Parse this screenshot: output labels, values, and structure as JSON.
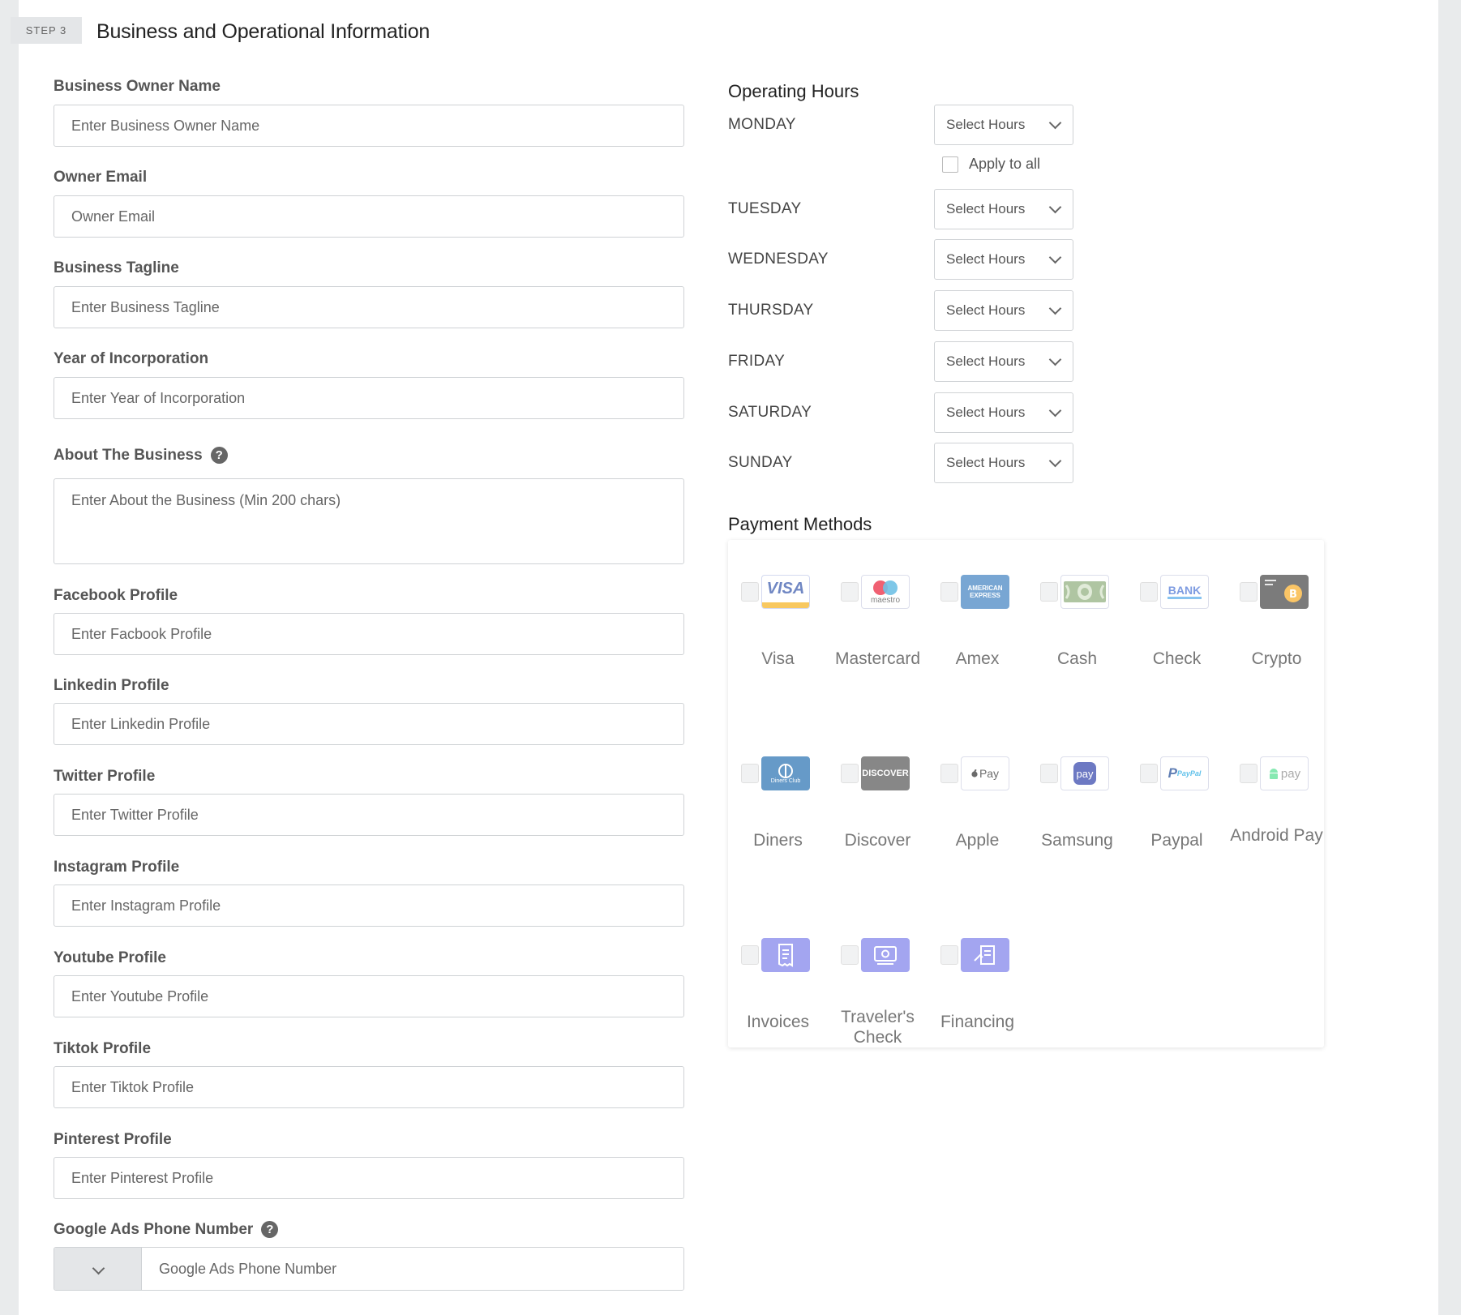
{
  "step": {
    "badge": "STEP 3",
    "title": "Business and Operational Information"
  },
  "left_fields": [
    {
      "label": "Business Owner Name",
      "placeholder": "Enter Business Owner Name"
    },
    {
      "label": "Owner Email",
      "placeholder": "Owner Email"
    },
    {
      "label": "Business Tagline",
      "placeholder": "Enter Business Tagline"
    },
    {
      "label": "Year of Incorporation",
      "placeholder": "Enter Year of Incorporation"
    },
    {
      "label": "About The Business",
      "placeholder": "Enter About the Business (Min 200 chars)"
    },
    {
      "label": "Facebook Profile",
      "placeholder": "Enter Facbook Profile"
    },
    {
      "label": "Linkedin Profile",
      "placeholder": "Enter Linkedin Profile"
    },
    {
      "label": "Twitter Profile",
      "placeholder": "Enter Twitter Profile"
    },
    {
      "label": "Instagram Profile",
      "placeholder": "Enter Instagram Profile"
    },
    {
      "label": "Youtube Profile",
      "placeholder": "Enter Youtube Profile"
    },
    {
      "label": "Tiktok Profile",
      "placeholder": "Enter Tiktok Profile"
    },
    {
      "label": "Pinterest Profile",
      "placeholder": "Enter Pinterest Profile"
    },
    {
      "label": "Google Ads Phone Number",
      "placeholder": "Google Ads Phone Number"
    }
  ],
  "help_icon_glyph": "?",
  "operating_hours": {
    "title": "Operating Hours",
    "apply_all": "Apply to all",
    "days": [
      {
        "name": "MONDAY",
        "value": "Select Hours"
      },
      {
        "name": "TUESDAY",
        "value": "Select Hours"
      },
      {
        "name": "WEDNESDAY",
        "value": "Select Hours"
      },
      {
        "name": "THURSDAY",
        "value": "Select Hours"
      },
      {
        "name": "FRIDAY",
        "value": "Select Hours"
      },
      {
        "name": "SATURDAY",
        "value": "Select Hours"
      },
      {
        "name": "SUNDAY",
        "value": "Select Hours"
      }
    ]
  },
  "payment_methods": {
    "title": "Payment Methods",
    "items": [
      {
        "label": "Visa",
        "icon": "visa-icon",
        "logo_text": "VISA"
      },
      {
        "label": "Mastercard",
        "icon": "maestro-icon",
        "logo_text": "maestro"
      },
      {
        "label": "Amex",
        "icon": "amex-icon",
        "logo_text": "AMERICAN EXPRESS"
      },
      {
        "label": "Cash",
        "icon": "cash-icon",
        "logo_text": ""
      },
      {
        "label": "Check",
        "icon": "bank-transfer-icon",
        "logo_text": "BANK"
      },
      {
        "label": "Crypto",
        "icon": "bitcoin-card-icon",
        "logo_text": ""
      },
      {
        "label": "Diners",
        "icon": "diners-club-icon",
        "logo_text": "Diners Club"
      },
      {
        "label": "Discover",
        "icon": "discover-icon",
        "logo_text": "DISCOVER"
      },
      {
        "label": "Apple",
        "icon": "apple-pay-icon",
        "logo_text": "Pay"
      },
      {
        "label": "Samsung",
        "icon": "samsung-pay-icon",
        "logo_text": "pay"
      },
      {
        "label": "Paypal",
        "icon": "paypal-icon",
        "logo_text": "PayPal"
      },
      {
        "label": "Android Pay",
        "icon": "android-pay-icon",
        "logo_text": "pay"
      },
      {
        "label": "Invoices",
        "icon": "invoice-icon",
        "logo_text": ""
      },
      {
        "label": "Traveler's Check",
        "icon": "travelers-check-icon",
        "logo_text": ""
      },
      {
        "label": "Financing",
        "icon": "financing-icon",
        "logo_text": ""
      }
    ]
  },
  "colors": {
    "page_bg": "#e9ebec",
    "panel_bg": "#ffffff",
    "logo_tint": "#8e9bf0"
  }
}
